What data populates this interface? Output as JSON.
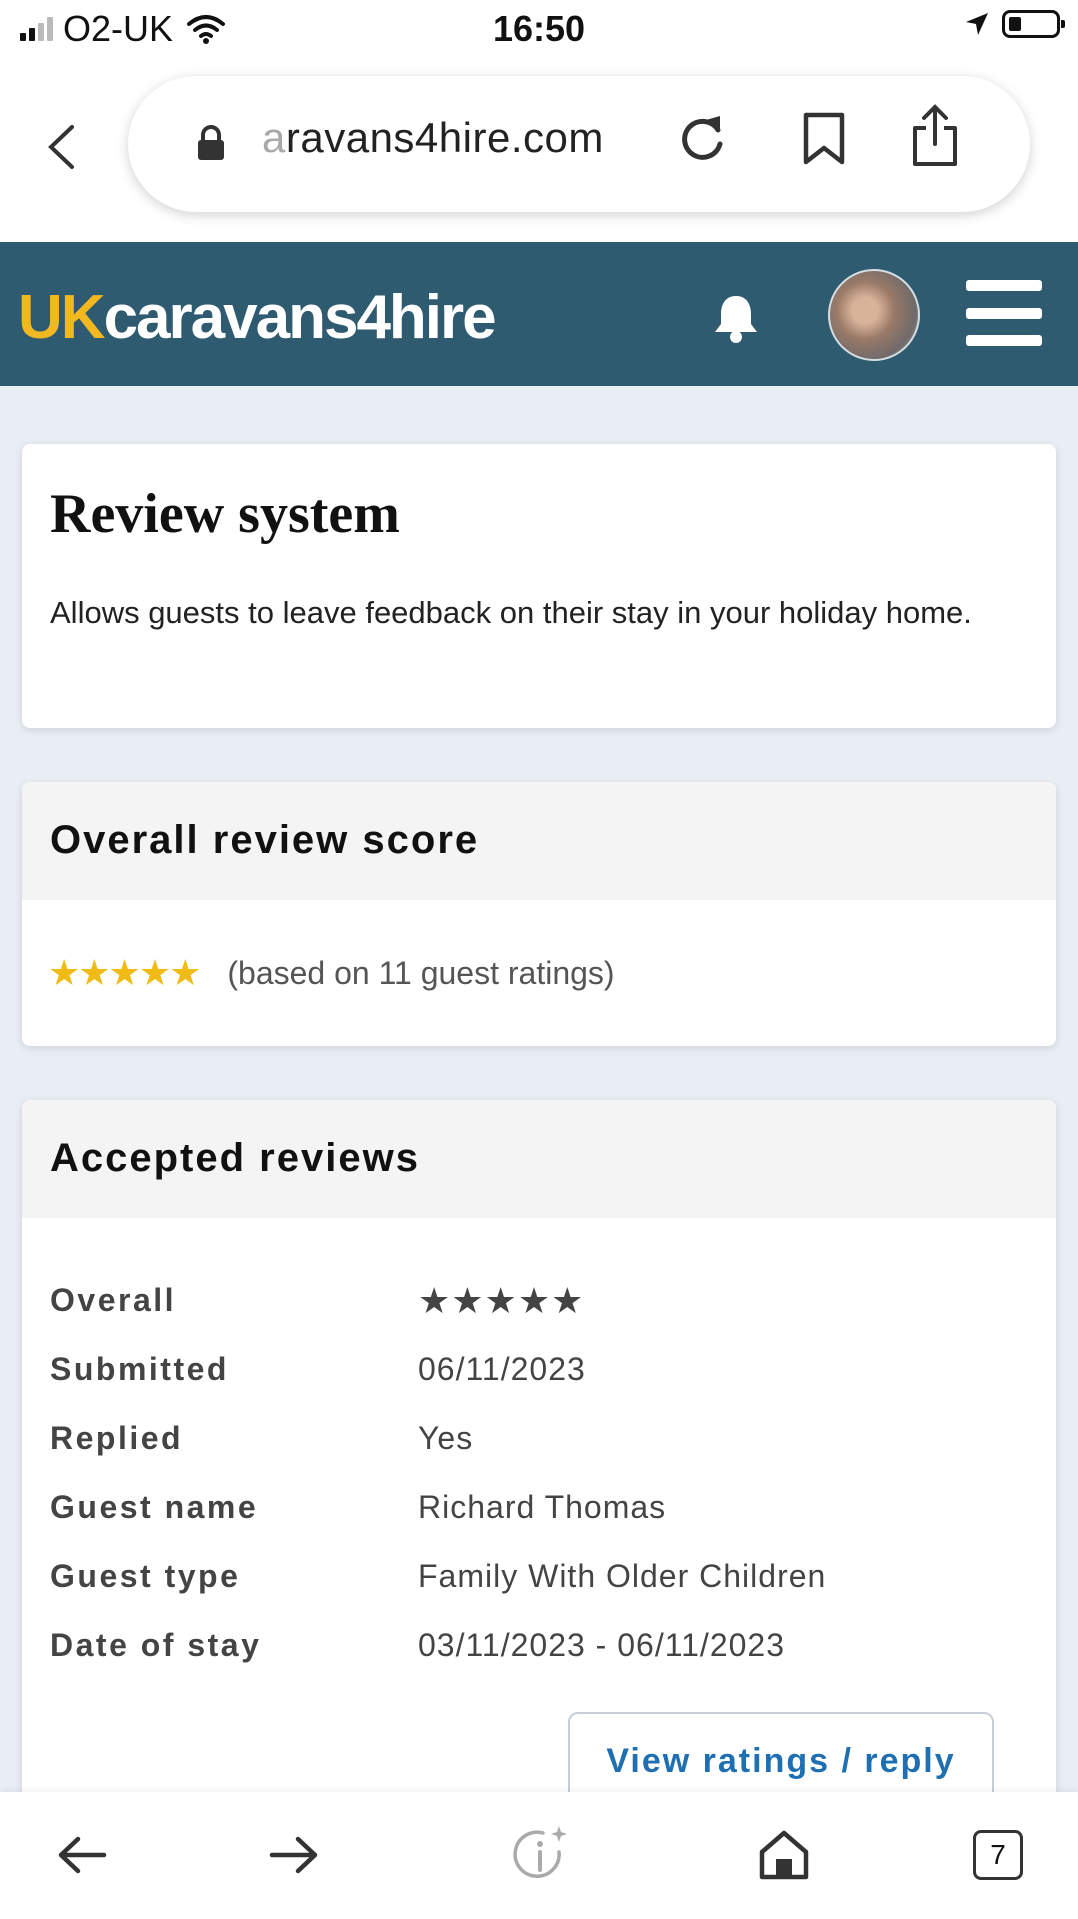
{
  "status_bar": {
    "carrier": "O2-UK",
    "time": "16:50"
  },
  "browser": {
    "url_faded": "a",
    "url_main": "ravans4hire.com"
  },
  "site": {
    "logo_uk": "UK",
    "logo_rest": "caravans4hire"
  },
  "intro_card": {
    "title": "Review system",
    "description": "Allows guests to leave feedback on their stay in your holiday home."
  },
  "score_card": {
    "title": "Overall review score",
    "stars": "★★★★★",
    "rating_value": 5,
    "note": "(based on 11 guest ratings)"
  },
  "reviews_card": {
    "title": "Accepted reviews",
    "rows": [
      {
        "label": "Overall",
        "value": "★★★★★"
      },
      {
        "label": "Submitted",
        "value": "06/11/2023"
      },
      {
        "label": "Replied",
        "value": "Yes"
      },
      {
        "label": "Guest name",
        "value": "Richard Thomas"
      },
      {
        "label": "Guest type",
        "value": "Family With Older Children"
      },
      {
        "label": "Date of stay",
        "value": "03/11/2023 - 06/11/2023"
      }
    ],
    "button_label": "View ratings / reply"
  },
  "toolbar": {
    "tab_count": "7"
  },
  "colors": {
    "header_bg": "#2f5b71",
    "logo_accent": "#f1b820",
    "star": "#f0bb15",
    "button_text": "#1f6fb3",
    "page_bg": "#e9eef4"
  },
  "icons": [
    "signal-icon",
    "wifi-icon",
    "location-arrow-icon",
    "battery-icon",
    "back-chevron-icon",
    "lock-icon",
    "reload-icon",
    "bookmark-icon",
    "share-icon",
    "bell-icon",
    "avatar",
    "hamburger-menu-icon",
    "arrow-left-icon",
    "arrow-right-icon",
    "info-sparkle-icon",
    "home-icon",
    "tabs-icon"
  ]
}
